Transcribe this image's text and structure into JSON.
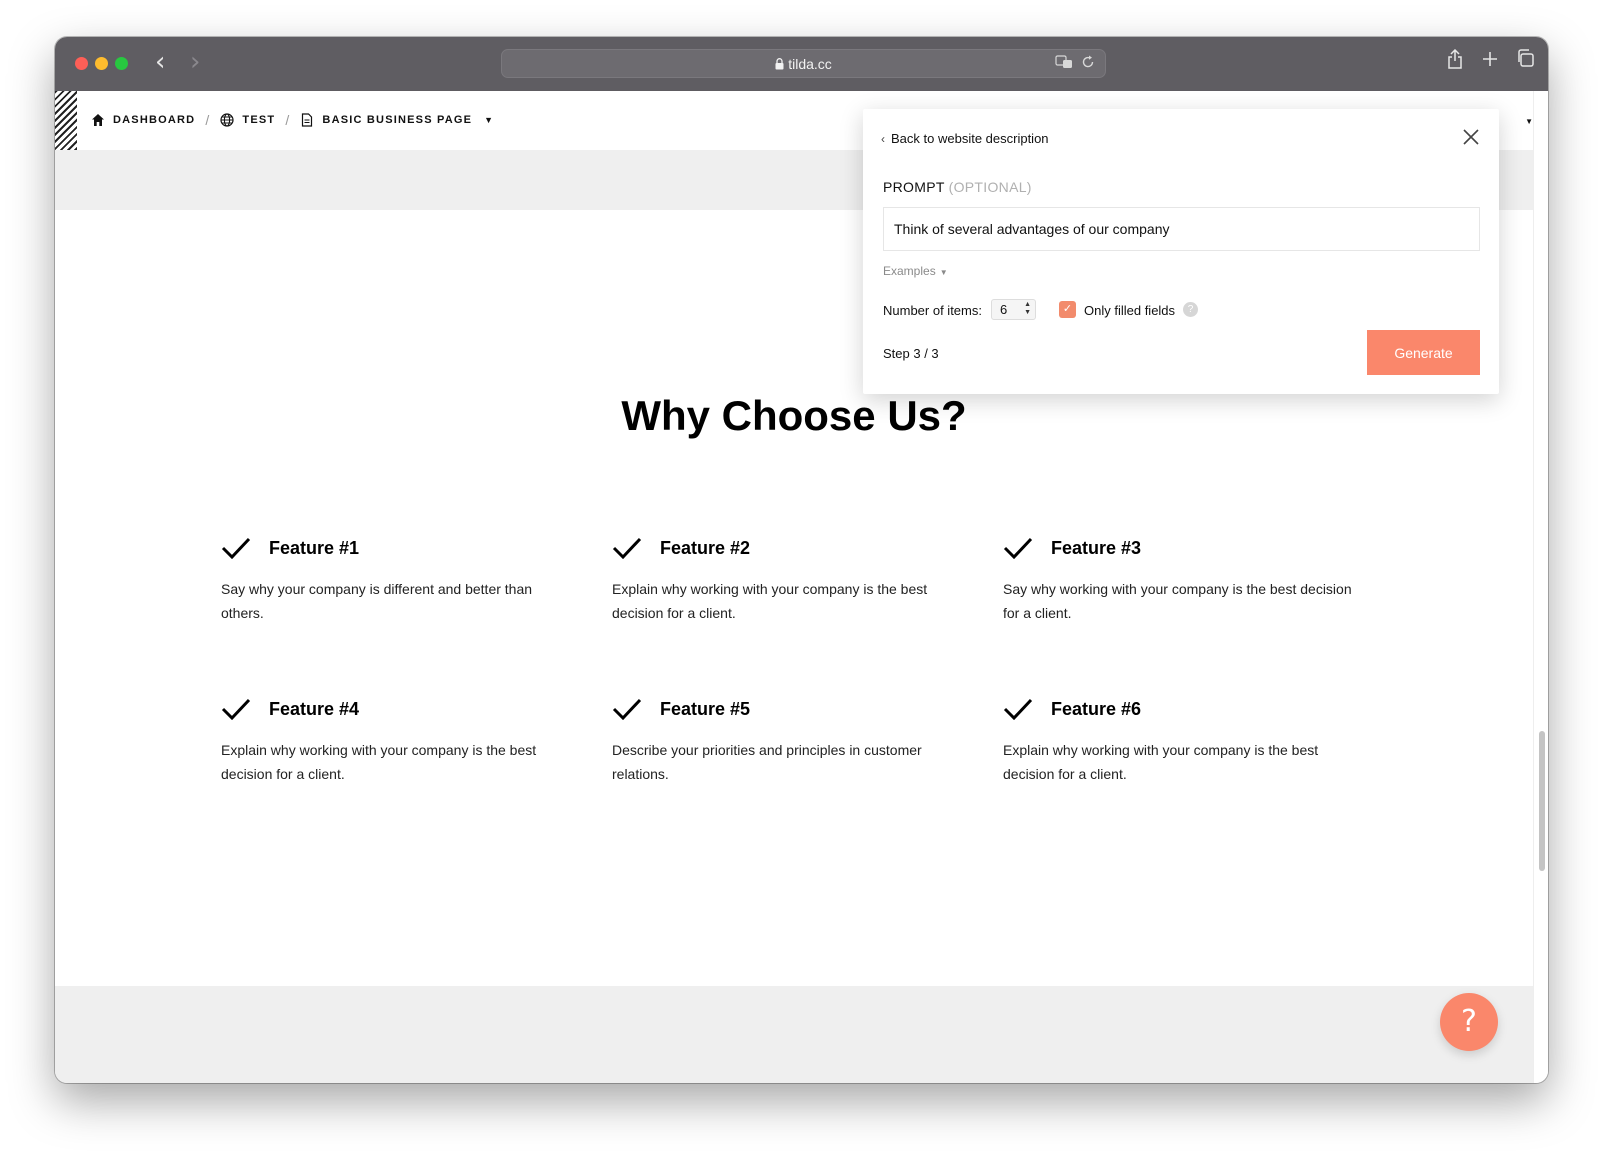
{
  "browser": {
    "url": "tilda.cc"
  },
  "breadcrumb": {
    "items": [
      {
        "label": "DASHBOARD",
        "icon": "home-icon"
      },
      {
        "label": "TEST",
        "icon": "globe-icon"
      },
      {
        "label": "BASIC BUSINESS PAGE",
        "icon": "page-icon"
      }
    ],
    "separator": "/"
  },
  "section": {
    "title": "Why Choose Us?"
  },
  "features": [
    {
      "title": "Feature #1",
      "description": "Say why your company is different and better than others."
    },
    {
      "title": "Feature #2",
      "description": "Explain why working with your company is the best decision for a client."
    },
    {
      "title": "Feature #3",
      "description": "Say why working with your company is the best decision for a client."
    },
    {
      "title": "Feature #4",
      "description": "Explain why working with your company is the best decision for a client."
    },
    {
      "title": "Feature #5",
      "description": "Describe your priorities and principles in customer relations."
    },
    {
      "title": "Feature #6",
      "description": "Explain why working with your company is the best decision for a client."
    }
  ],
  "popup": {
    "back_label": "Back to website description",
    "prompt_label": "PROMPT",
    "prompt_optional": "(OPTIONAL)",
    "prompt_value": "Think of several advantages of our company",
    "examples_label": "Examples",
    "number_label": "Number of items:",
    "number_value": "6",
    "only_filled_label": "Only filled fields",
    "only_filled_checked": true,
    "help_glyph": "?",
    "step_label": "Step 3 / 3",
    "generate_label": "Generate"
  },
  "help_fab": {
    "glyph": "?"
  },
  "colors": {
    "accent": "#fa876b",
    "chrome": "#5f5d62",
    "page_gray": "#efefef"
  }
}
